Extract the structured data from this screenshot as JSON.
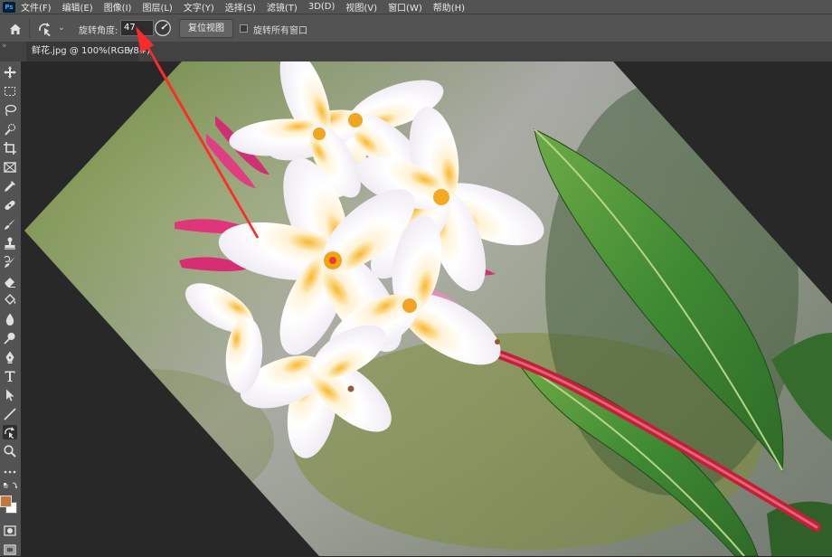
{
  "menubar": {
    "app_icon": "Ps",
    "items": [
      "文件(F)",
      "编辑(E)",
      "图像(I)",
      "图层(L)",
      "文字(Y)",
      "选择(S)",
      "滤镜(T)",
      "3D(D)",
      "视图(V)",
      "窗口(W)",
      "帮助(H)"
    ]
  },
  "options": {
    "rotation_label": "旋转角度:",
    "rotation_value": "47",
    "reset_view_label": "复位视图",
    "rotate_all_label": "旋转所有窗口",
    "rotate_all_checked": false
  },
  "document": {
    "tab_title": "鲜花.jpg @ 100%(RGB/8#)",
    "close_glyph": "×"
  },
  "toolbar": {
    "tools": [
      "move-tool",
      "marquee-tool",
      "lasso-tool",
      "quick-select-tool",
      "crop-tool",
      "frame-tool",
      "eyedropper-tool",
      "healing-brush-tool",
      "brush-tool",
      "clone-stamp-tool",
      "history-brush-tool",
      "eraser-tool",
      "paint-bucket-tool",
      "blur-tool",
      "dodge-tool",
      "pen-tool",
      "type-tool",
      "path-select-tool",
      "line-tool",
      "rotate-view-tool",
      "zoom-tool",
      "more-tools"
    ],
    "active_tool": "rotate-view-tool",
    "foreground_color": "#c0783c",
    "background_color": "#ffffff"
  },
  "annotation": {
    "arrow_color": "#ff2a2a"
  }
}
